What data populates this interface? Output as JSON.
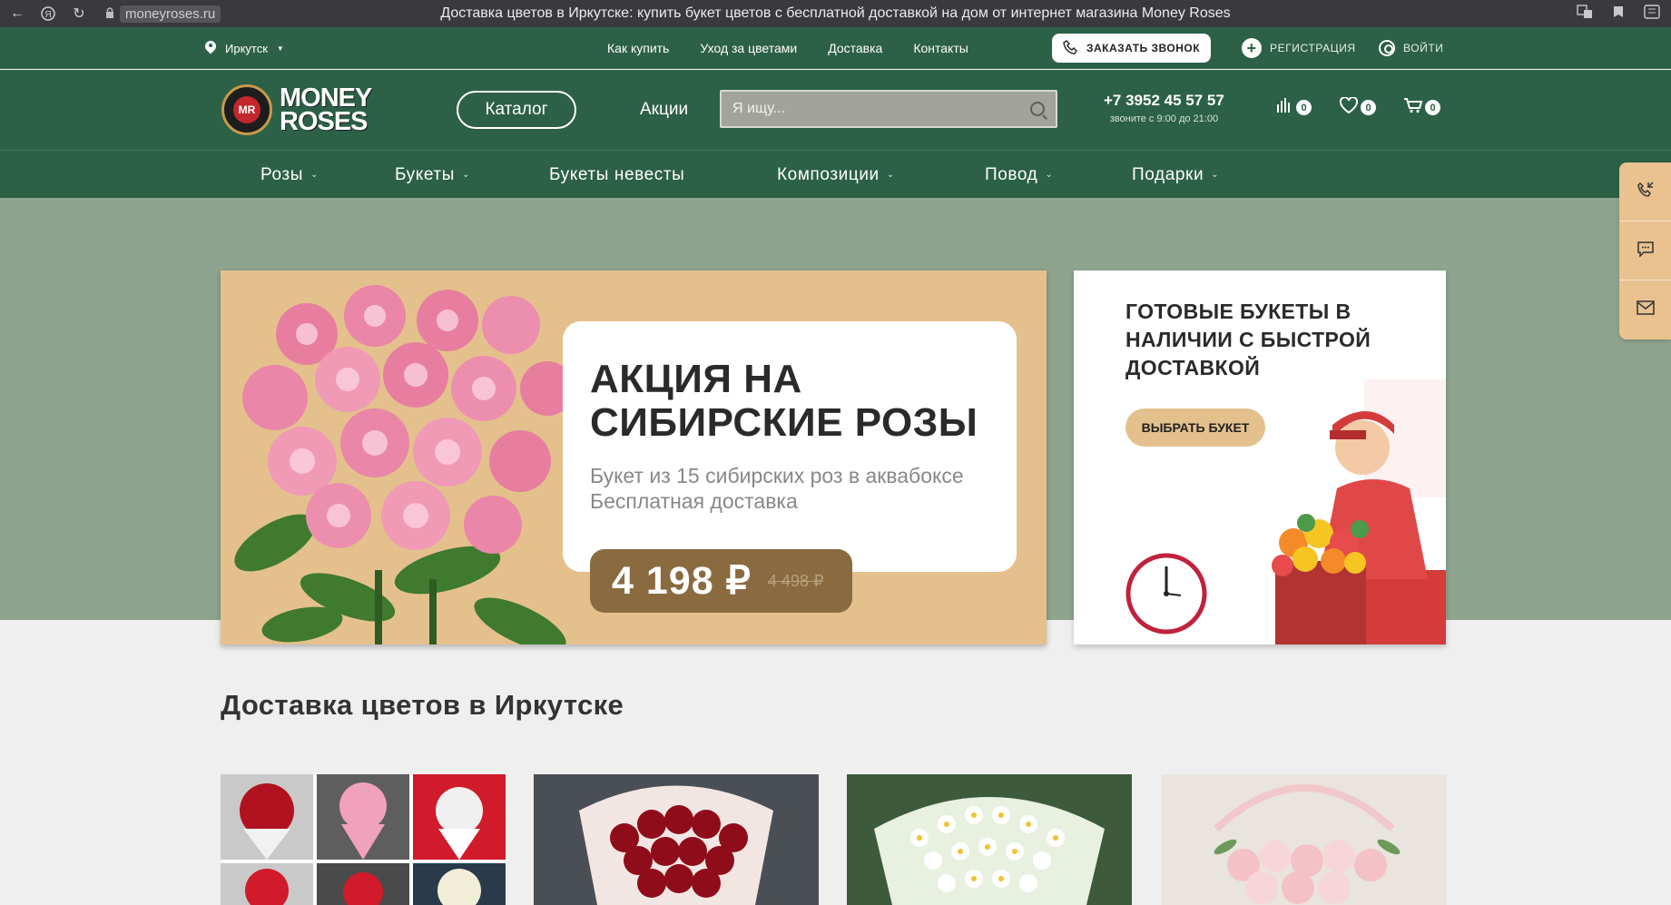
{
  "browser": {
    "url": "moneyroses.ru",
    "page_title": "Доставка цветов в Иркутске: купить букет цветов с бесплатной доставкой на дом от интернет магазина Money Roses"
  },
  "top_bar": {
    "city": "Иркутск",
    "links": [
      "Как купить",
      "Уход за цветами",
      "Доставка",
      "Контакты"
    ],
    "call_button": "ЗАКАЗАТЬ ЗВОНОК",
    "register": "РЕГИСТРАЦИЯ",
    "login": "ВОЙТИ"
  },
  "header": {
    "logo_line1": "MONEY",
    "logo_line2": "ROSES",
    "logo_badge": "MR",
    "catalog": "Каталог",
    "promo": "Акции",
    "search_placeholder": "Я ищу...",
    "phone": "+7 3952 45 57 57",
    "hours": "звоните с 9:00 до 21:00",
    "compare_count": "0",
    "favorites_count": "0",
    "cart_count": "0"
  },
  "categories": [
    {
      "label": "Розы",
      "has_dropdown": true
    },
    {
      "label": "Букеты",
      "has_dropdown": true
    },
    {
      "label": "Букеты невесты",
      "has_dropdown": false
    },
    {
      "label": "Композиции",
      "has_dropdown": true
    },
    {
      "label": "Повод",
      "has_dropdown": true
    },
    {
      "label": "Подарки",
      "has_dropdown": true
    }
  ],
  "main_banner": {
    "title_line1": "АКЦИЯ НА",
    "title_line2": "СИБИРСКИЕ РОЗЫ",
    "sub_line1": "Букет из 15 сибирских роз в аквабоксе",
    "sub_line2": "Бесплатная доставка",
    "price_new": "4 198 ₽",
    "price_old": "4 498 ₽"
  },
  "side_banner": {
    "title": "ГОТОВЫЕ БУКЕТЫ В НАЛИЧИИ С БЫСТРОЙ ДОСТАВКОЙ",
    "button": "ВЫБРАТЬ БУКЕТ"
  },
  "floating_panel": [
    "phone-callback-icon",
    "chat-icon",
    "mail-icon"
  ],
  "section": {
    "title": "Доставка цветов в Иркутске"
  },
  "colors": {
    "brand_green": "#2c6047",
    "hero_bg": "#8ea48e",
    "beige": "#e4c18c",
    "price_brown": "#8a6b40"
  }
}
